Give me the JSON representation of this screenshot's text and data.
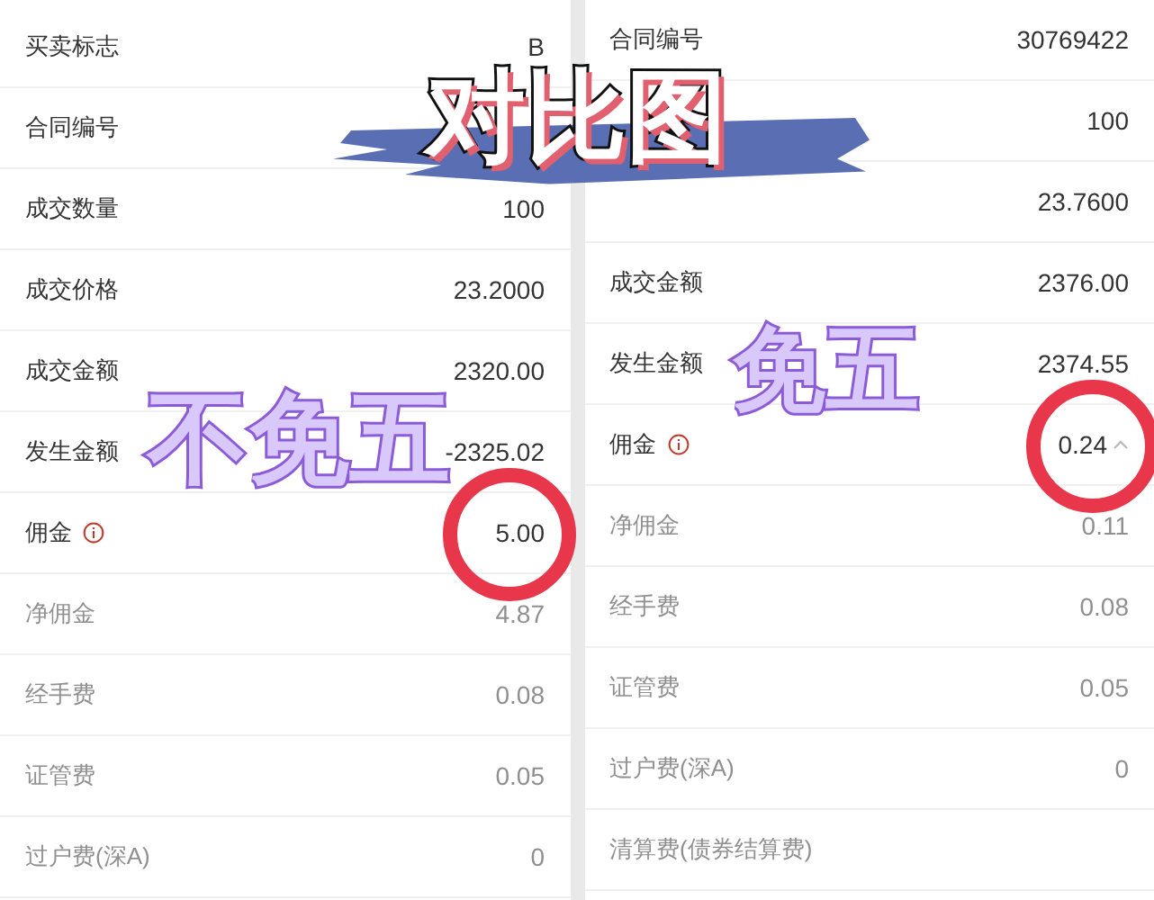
{
  "title_sticker": "对比图",
  "panels": [
    {
      "tag": "不免五",
      "rows": [
        {
          "label": "买卖标志",
          "value": "B",
          "kind": "primary",
          "info": false,
          "circled": false,
          "chevron": false
        },
        {
          "label": "合同编号",
          "kind": "primary",
          "info": false,
          "circled": false,
          "chevron": false
        },
        {
          "label": "成交数量",
          "value": "100",
          "kind": "primary",
          "info": false,
          "circled": false,
          "chevron": false
        },
        {
          "label": "成交价格",
          "value": "23.2000",
          "kind": "primary",
          "info": false,
          "circled": false,
          "chevron": false
        },
        {
          "label": "成交金额",
          "value": "2320.00",
          "kind": "primary",
          "info": false,
          "circled": false,
          "chevron": false
        },
        {
          "label": "发生金额",
          "value": "-2325.02",
          "kind": "primary",
          "info": false,
          "circled": false,
          "chevron": false
        },
        {
          "label": "佣金",
          "value": "5.00",
          "kind": "primary",
          "info": true,
          "circled": true,
          "chevron": false
        },
        {
          "label": "净佣金",
          "value": "4.87",
          "kind": "secondary",
          "info": false,
          "circled": false,
          "chevron": false
        },
        {
          "label": "经手费",
          "value": "0.08",
          "kind": "secondary",
          "info": false,
          "circled": false,
          "chevron": false
        },
        {
          "label": "证管费",
          "value": "0.05",
          "kind": "secondary",
          "info": false,
          "circled": false,
          "chevron": false
        },
        {
          "label": "过户费(深A)",
          "value": "0",
          "kind": "secondary",
          "info": false,
          "circled": false,
          "chevron": false
        }
      ]
    },
    {
      "tag": "免五",
      "rows": [
        {
          "label": "合同编号",
          "value": "30769422",
          "kind": "primary",
          "info": false,
          "circled": false,
          "chevron": false
        },
        {
          "value": "100",
          "kind": "primary",
          "info": false,
          "circled": false,
          "chevron": false
        },
        {
          "value": "23.7600",
          "kind": "primary",
          "info": false,
          "circled": false,
          "chevron": false
        },
        {
          "label": "成交金额",
          "value": "2376.00",
          "kind": "primary",
          "info": false,
          "circled": false,
          "chevron": false
        },
        {
          "label": "发生金额",
          "value": "2374.55",
          "kind": "primary",
          "info": false,
          "circled": false,
          "chevron": false
        },
        {
          "label": "佣金",
          "value": "0.24",
          "kind": "primary",
          "info": true,
          "circled": true,
          "chevron": true
        },
        {
          "label": "净佣金",
          "value": "0.11",
          "kind": "secondary",
          "info": false,
          "circled": false,
          "chevron": false
        },
        {
          "label": "经手费",
          "value": "0.08",
          "kind": "secondary",
          "info": false,
          "circled": false,
          "chevron": false
        },
        {
          "label": "证管费",
          "value": "0.05",
          "kind": "secondary",
          "info": false,
          "circled": false,
          "chevron": false
        },
        {
          "label": "过户费(深A)",
          "value": "0",
          "kind": "secondary",
          "info": false,
          "circled": false,
          "chevron": false
        },
        {
          "label": "清算费(债券结算费)",
          "kind": "secondary",
          "info": false,
          "circled": false,
          "chevron": false
        }
      ]
    }
  ]
}
